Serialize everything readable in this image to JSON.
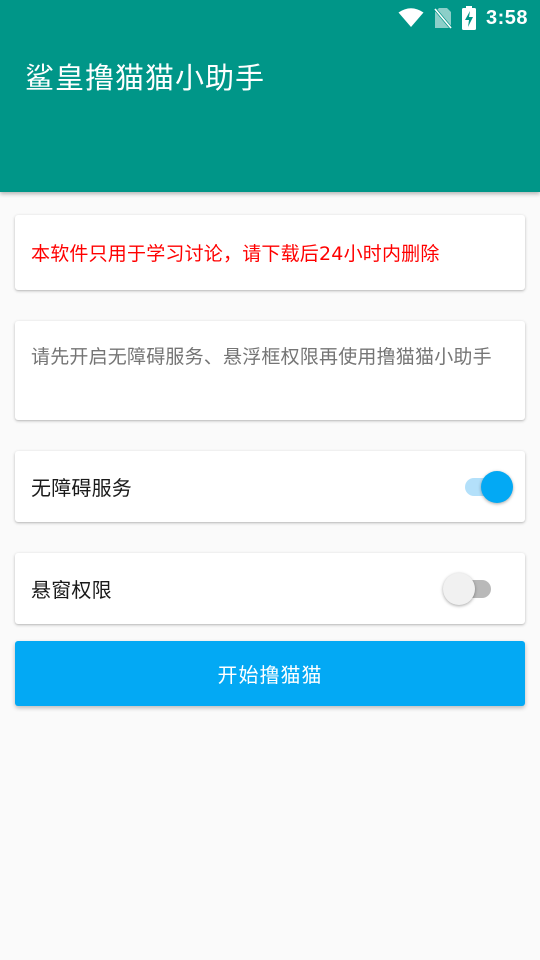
{
  "status_bar": {
    "time": "3:58",
    "icons": [
      "wifi-icon",
      "no-sim-icon",
      "battery-charging-icon"
    ]
  },
  "app_bar": {
    "title": "鲨皇撸猫猫小助手",
    "color": "#009688"
  },
  "notice": {
    "text": "本软件只用于学习讨论，请下载后24小时内删除",
    "color": "#ff0000"
  },
  "hint": {
    "text": "请先开启无障碍服务、悬浮框权限再使用撸猫猫小助手"
  },
  "settings": [
    {
      "label": "无障碍服务",
      "enabled": true
    },
    {
      "label": "悬窗权限",
      "enabled": false
    }
  ],
  "start_button": {
    "label": "开始撸猫猫",
    "color": "#03a9f4"
  },
  "accent_color": "#03a9f4"
}
